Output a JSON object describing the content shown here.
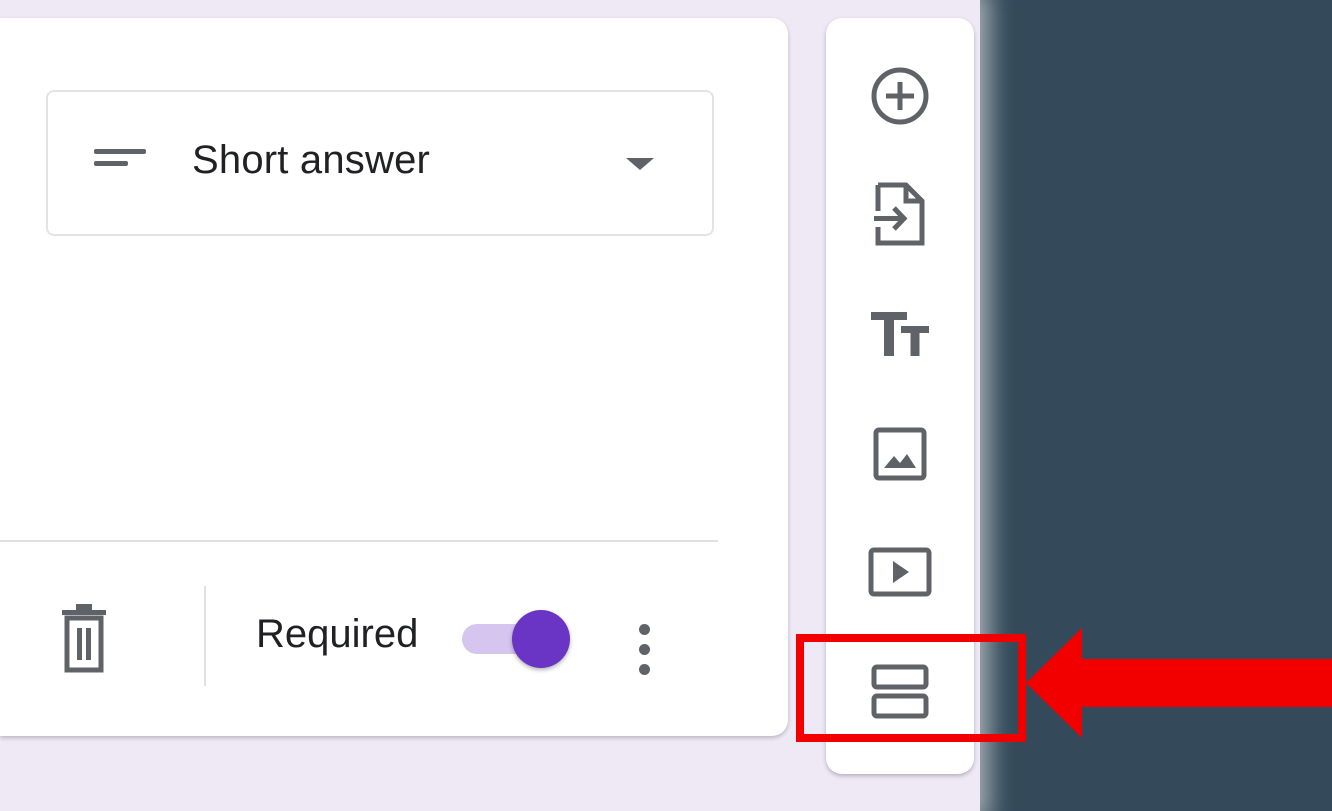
{
  "question": {
    "type_dropdown": {
      "selected_label": "Short answer",
      "icon": "short-text-icon"
    },
    "footer": {
      "delete_icon": "trash-icon",
      "required_label": "Required",
      "required_enabled": true,
      "more_icon": "more-vert-icon"
    }
  },
  "toolbar": {
    "items": [
      {
        "name": "add-question",
        "icon": "add-circle-icon"
      },
      {
        "name": "import-questions",
        "icon": "import-file-icon"
      },
      {
        "name": "add-title-and-description",
        "icon": "text-format-icon"
      },
      {
        "name": "add-image",
        "icon": "image-icon"
      },
      {
        "name": "add-video",
        "icon": "video-icon"
      },
      {
        "name": "add-section",
        "icon": "section-icon",
        "highlighted": true
      }
    ]
  },
  "annotation": {
    "highlight_color": "#f20000",
    "arrow_color": "#f20000"
  },
  "colors": {
    "accent": "#6a35c4",
    "toggle_track": "#d6c6ef",
    "page_background": "#efe9f6",
    "outer_background": "#344a5a"
  }
}
